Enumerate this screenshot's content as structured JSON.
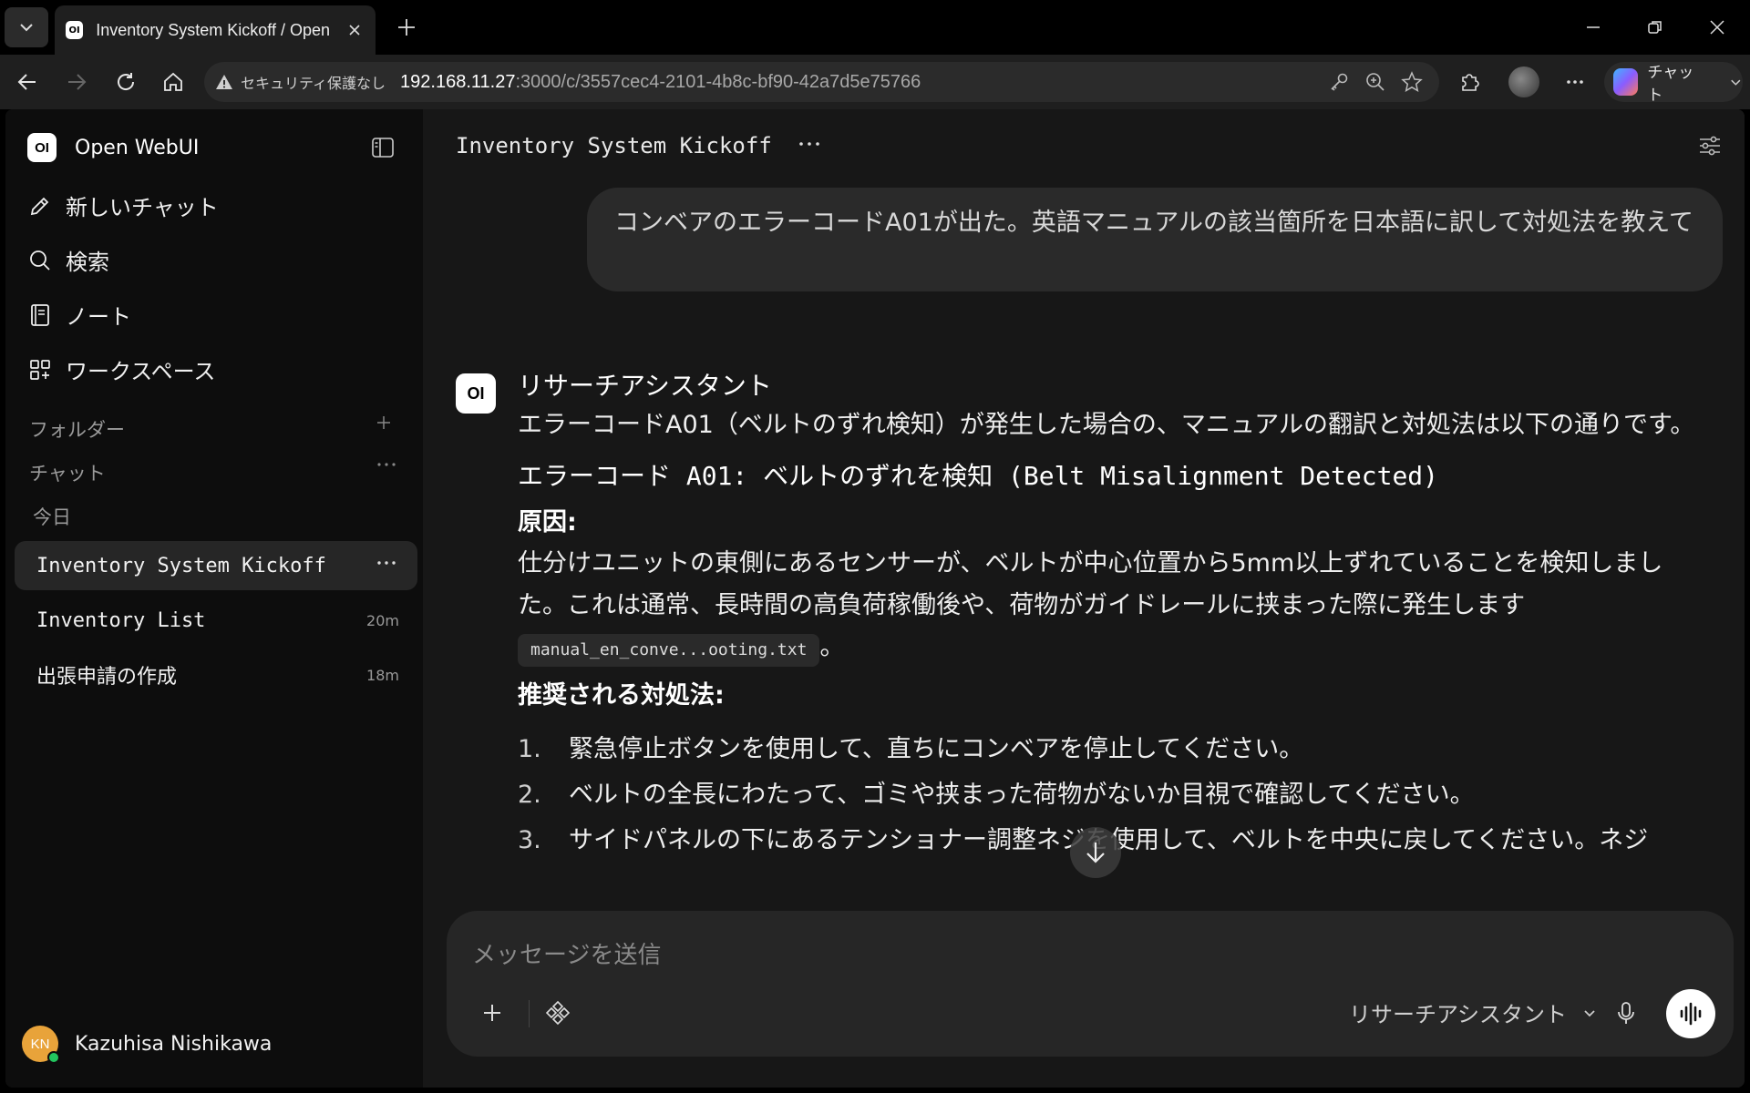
{
  "browser": {
    "tab_title": "Inventory System Kickoff / Open WebUI",
    "tab_favicon": "OI",
    "security_warning": "セキュリティ保護なし",
    "url_host": "192.168.11.27",
    "url_path": ":3000/c/3557cec4-2101-4b8c-bf90-42a7d5e75766",
    "copilot_label": "チャット"
  },
  "sidebar": {
    "logo": "OI",
    "brand": "Open WebUI",
    "nav": [
      {
        "label": "新しいチャット",
        "icon": "pencil-icon"
      },
      {
        "label": "検索",
        "icon": "search-icon"
      },
      {
        "label": "ノート",
        "icon": "notebook-icon"
      },
      {
        "label": "ワークスペース",
        "icon": "grid-icon"
      }
    ],
    "folders_label": "フォルダー",
    "chats_label": "チャット",
    "today_label": "今日",
    "chats": [
      {
        "title": "Inventory System Kickoff",
        "meta": "",
        "active": true
      },
      {
        "title": "Inventory List",
        "meta": "20m"
      },
      {
        "title": "出張申請の作成",
        "meta": "18m"
      }
    ],
    "user": {
      "initials": "KN",
      "name": "Kazuhisa Nishikawa"
    }
  },
  "chat": {
    "title": "Inventory System Kickoff",
    "user_message": "コンベアのエラーコードA01が出た。英語マニュアルの該当箇所を日本語に訳して対処法を教えて",
    "assistant": {
      "badge": "OI",
      "name": "リサーチアシスタント",
      "intro": "エラーコードA01（ベルトのずれ検知）が発生した場合の、マニュアルの翻訳と対処法は以下の通りです。",
      "heading": "エラーコード A01: ベルトのずれを検知 (Belt Misalignment Detected)",
      "cause_label": "原因:",
      "cause_text": "仕分けユニットの東側にあるセンサーが、ベルトが中心位置から5mm以上ずれていることを検知しました。これは通常、長時間の高負荷稼働後や、荷物がガイドレールに挟まった際に発生します",
      "citation": "manual_en_conve...ooting.txt",
      "cause_end": "。",
      "actions_label": "推奨される対処法:",
      "steps": [
        {
          "n": "1.",
          "text": "緊急停止ボタンを使用して、直ちにコンベアを停止してください。"
        },
        {
          "n": "2.",
          "text": "ベルトの全長にわたって、ゴミや挟まった荷物がないか目視で確認してください。"
        },
        {
          "n": "3.",
          "text": "サイドパネルの下にあるテンショナー調整ネジを使用して、ベルトを中央に戻してください。ネジ"
        }
      ]
    }
  },
  "composer": {
    "placeholder": "メッセージを送信",
    "model": "リサーチアシスタント"
  }
}
